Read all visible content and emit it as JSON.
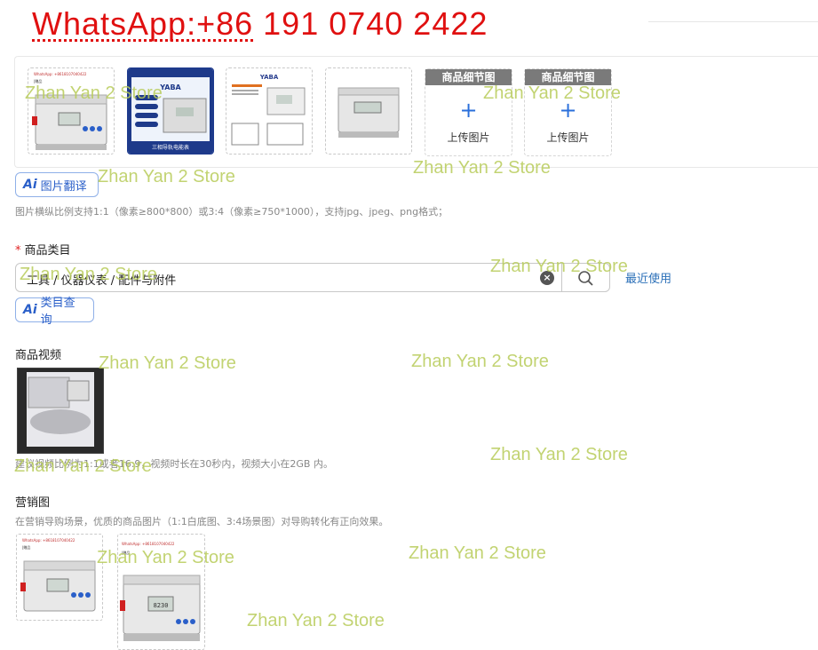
{
  "banner": {
    "text": "WhatsApp:+86 191 0740 2422"
  },
  "images": {
    "slots": [
      {
        "label": "商品细节图",
        "upload": "上传图片"
      },
      {
        "label": "商品细节图",
        "upload": "上传图片"
      }
    ],
    "thumb_texts": {
      "brand": "YABA",
      "product_name": "三相导轨电能表",
      "lcd": "8230",
      "whatsapp_small": "WhatsApp: +8618107040422",
      "tag_small": "|赠品"
    },
    "translate_button": "图片翻译",
    "hint": "图片横纵比例支持1:1（像素≥800*800）或3:4（像素≥750*1000），支持jpg、jpeg、png格式；"
  },
  "category": {
    "required_mark": "*",
    "label": "商品类目",
    "value": "工具 / 仪器仪表 / 配件与附件",
    "recent": "最近使用",
    "ai_button": "类目查询"
  },
  "video": {
    "label": "商品视频",
    "hint": "建议视频比例为1:1或者16:9，视频时长在30秒内，视频大小在2GB 内。"
  },
  "marketing": {
    "label": "营销图",
    "hint": "在营销导购场景，优质的商品图片（1:1白底图、3:4场景图）对导购转化有正向效果。"
  },
  "watermark": "Zhan Yan 2 Store",
  "colors": {
    "accent": "#2a5fc9",
    "banner": "#e01010",
    "watermark": "#b8cc5a"
  }
}
